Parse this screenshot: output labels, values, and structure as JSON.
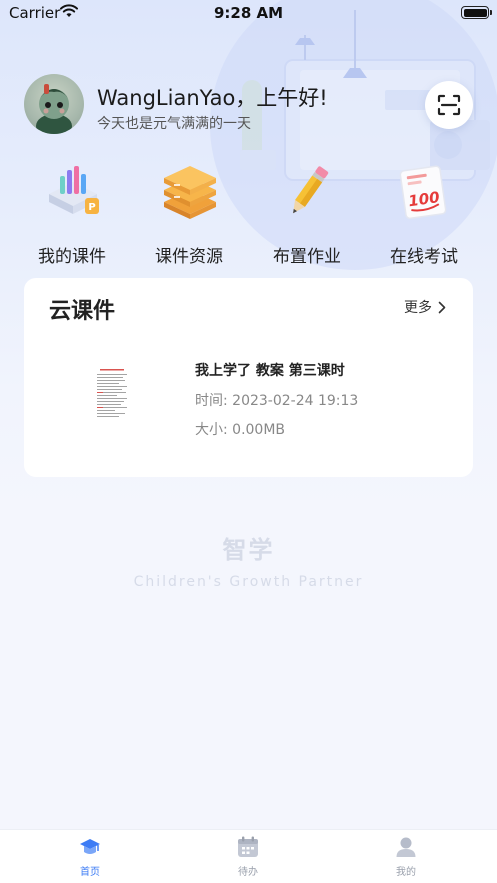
{
  "status_bar": {
    "carrier": "Carrier",
    "time": "9:28 AM"
  },
  "header": {
    "greeting": "WangLianYao，上午好!",
    "subtitle": "今天也是元气满满的一天"
  },
  "quick_menu": [
    {
      "label": "我的课件",
      "icon": "courseware-icon"
    },
    {
      "label": "课件资源",
      "icon": "resource-stack-icon"
    },
    {
      "label": "布置作业",
      "icon": "pencil-icon"
    },
    {
      "label": "在线考试",
      "icon": "exam-paper-icon"
    }
  ],
  "cloud_courseware": {
    "title": "云课件",
    "more_label": "更多",
    "items": [
      {
        "name": "我上学了 教案 第三课时",
        "time": "时间: 2023-02-24 19:13",
        "size": "大小: 0.00MB"
      }
    ]
  },
  "watermark": {
    "title": "智学",
    "subtitle": "Children's Growth Partner"
  },
  "tab_bar": [
    {
      "label": "首页",
      "icon": "home-cap-icon",
      "active": true
    },
    {
      "label": "待办",
      "icon": "calendar-icon",
      "active": false
    },
    {
      "label": "我的",
      "icon": "user-icon",
      "active": false
    }
  ],
  "colors": {
    "accent": "#3d7cf5",
    "tab_inactive": "#9aa0ac",
    "background": "#f4f6fd"
  }
}
